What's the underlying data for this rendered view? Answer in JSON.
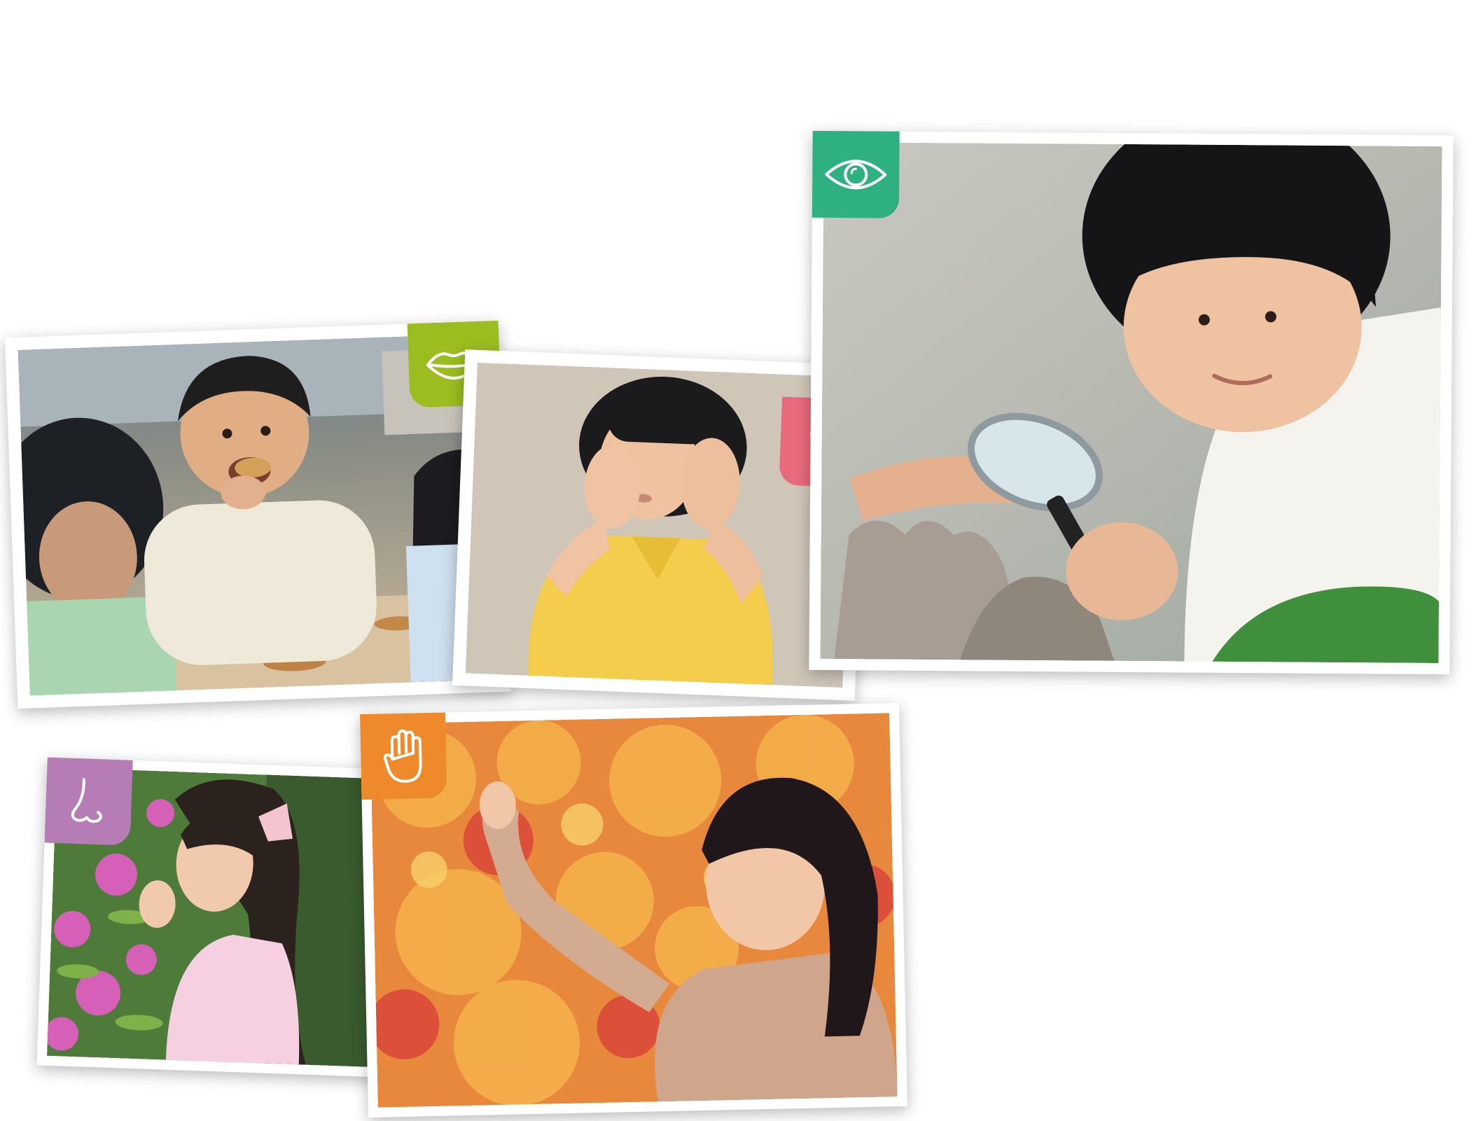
{
  "collage": {
    "photos": [
      {
        "id": "taste",
        "sense": "taste",
        "icon": "mouth-icon",
        "badge_color": "#9bbd1f"
      },
      {
        "id": "hearing",
        "sense": "hearing",
        "icon": "ear-icon",
        "badge_color": "#e86b7d"
      },
      {
        "id": "sight",
        "sense": "sight",
        "icon": "eye-icon",
        "badge_color": "#2fb081"
      },
      {
        "id": "smell",
        "sense": "smell",
        "icon": "nose-icon",
        "badge_color": "#b57cb6"
      },
      {
        "id": "touch",
        "sense": "touch",
        "icon": "hand-icon",
        "badge_color": "#ee8a2c"
      }
    ]
  }
}
